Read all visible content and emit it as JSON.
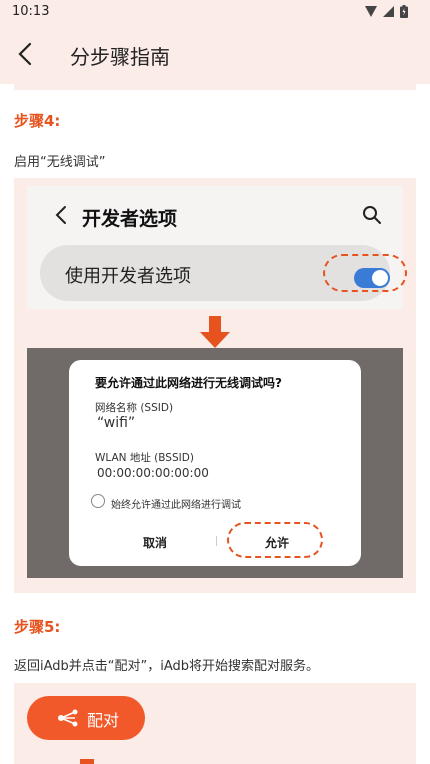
{
  "status_bar": {
    "time": "10:13"
  },
  "header": {
    "title": "分步骤指南"
  },
  "step4": {
    "label": "步骤4:",
    "text": "启用“无线调试”",
    "dev_options_title": "开发者选项",
    "use_dev_options_label": "使用开发者选项",
    "toggle_state": "on"
  },
  "dialog": {
    "title": "要允许通过此网络进行无线调试吗?",
    "network_name_label": "网络名称 (SSID)",
    "network_name_value": "“wifi”",
    "bssid_label": "WLAN 地址 (BSSID)",
    "bssid_value": "00:00:00:00:00:00",
    "always_allow_label": "始终允许通过此网络进行调试",
    "cancel_label": "取消",
    "allow_label": "允许"
  },
  "step5": {
    "label": "步骤5:",
    "text": "返回iAdb并点击“配对”，iAdb将开始搜索配对服务。",
    "pair_button_label": "配对"
  },
  "colors": {
    "accent": "#e6531f",
    "card_bg": "#fbece7",
    "toggle_on": "#3a7bd5"
  }
}
